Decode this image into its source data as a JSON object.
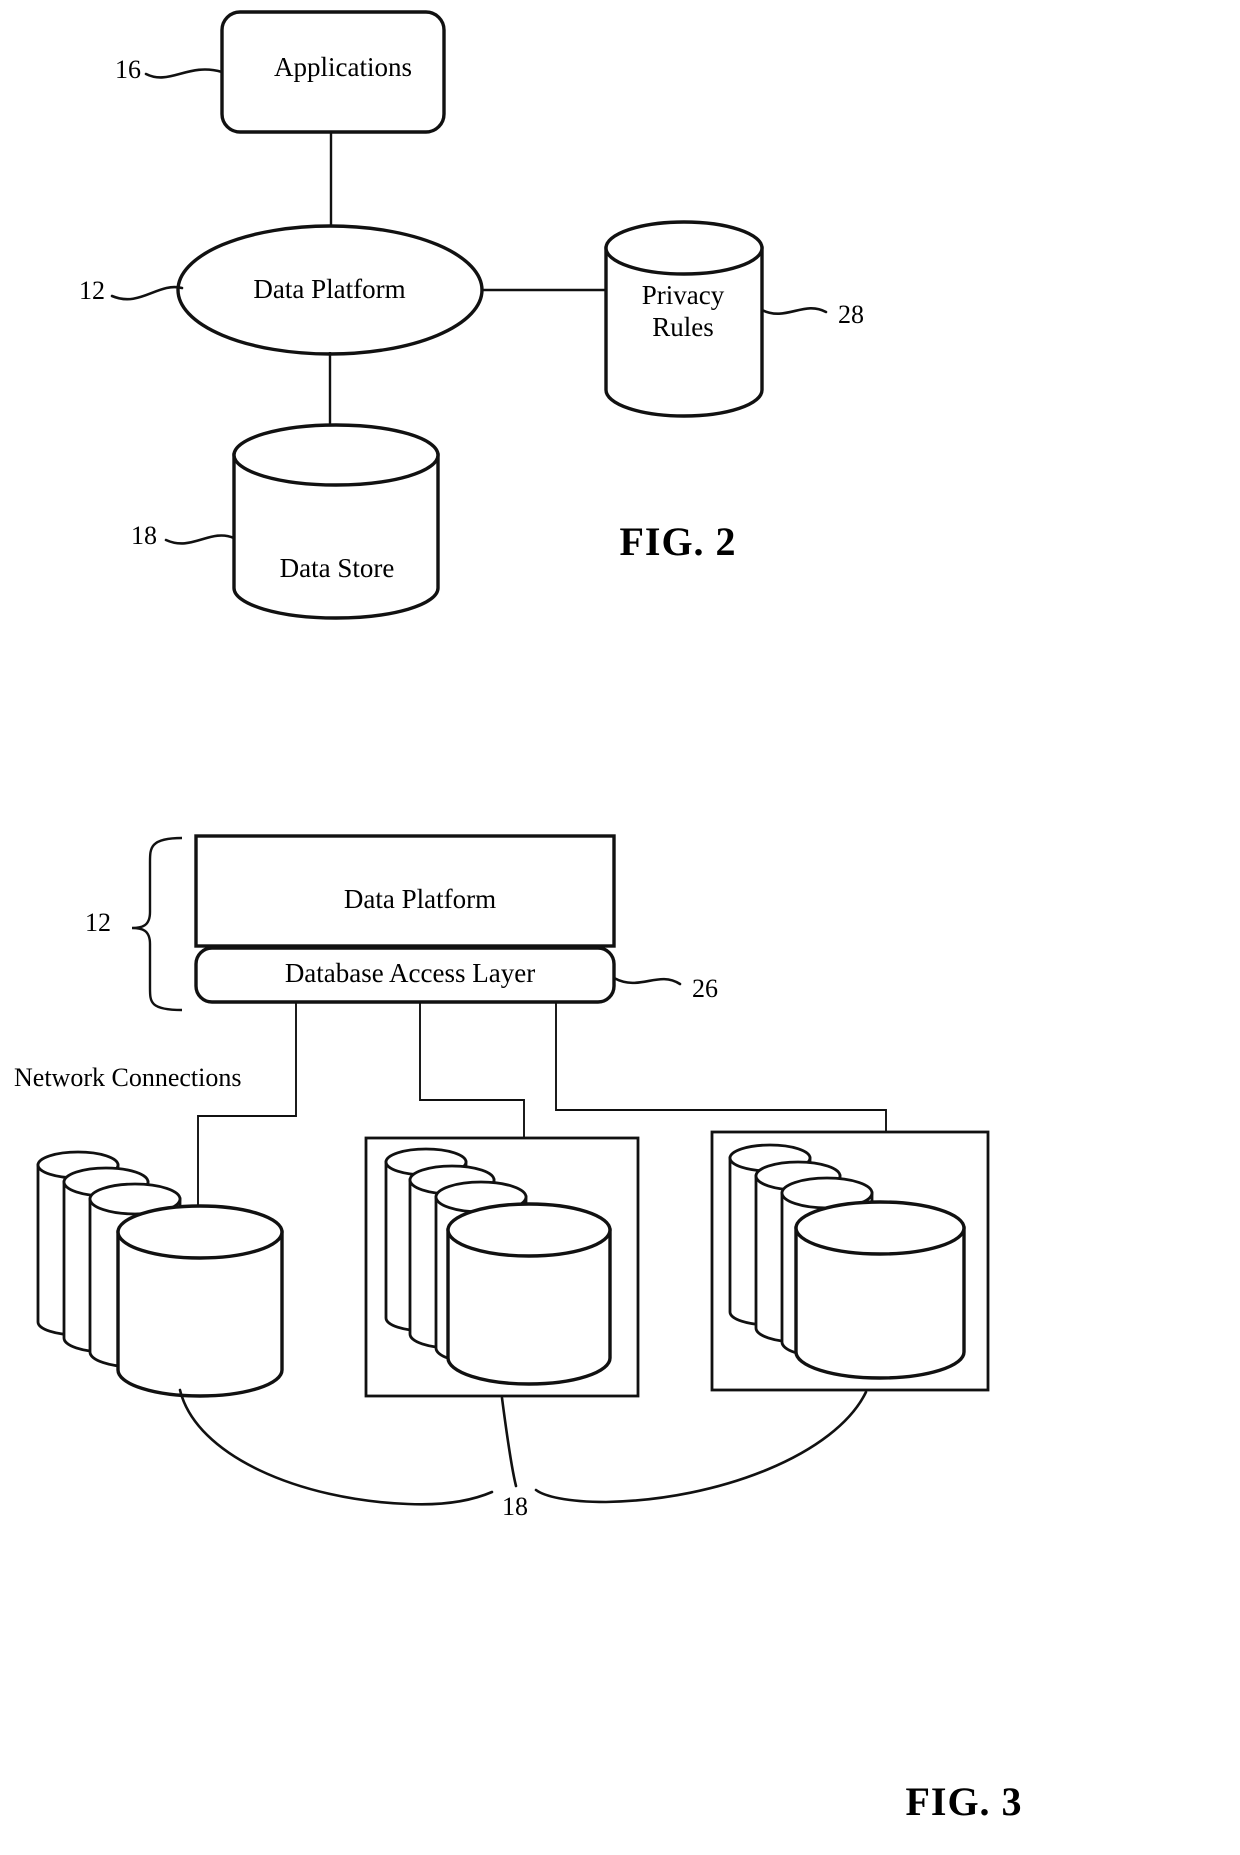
{
  "document": {
    "type": "patent-drawing-sheet",
    "figures": [
      "FIG. 2",
      "FIG. 3"
    ]
  },
  "fig2": {
    "caption": "FIG. 2",
    "nodes": {
      "applications": {
        "label": "Applications",
        "ref": "16",
        "shape": "rounded-rect"
      },
      "data_platform": {
        "label": "Data Platform",
        "ref": "12",
        "shape": "ellipse"
      },
      "privacy_rules": {
        "label": "Privacy Rules",
        "label_line1": "Privacy",
        "label_line2": "Rules",
        "ref": "28",
        "shape": "cylinder"
      },
      "data_store": {
        "label": "Data Store",
        "ref": "18",
        "shape": "cylinder"
      }
    },
    "connections": [
      {
        "from": "applications",
        "to": "data_platform"
      },
      {
        "from": "data_platform",
        "to": "privacy_rules"
      },
      {
        "from": "data_platform",
        "to": "data_store"
      }
    ]
  },
  "fig3": {
    "caption": "FIG. 3",
    "nodes": {
      "data_platform": {
        "label": "Data Platform",
        "ref": "12",
        "shape": "rect"
      },
      "database_access_layer": {
        "label": "Database Access Layer",
        "ref": "26",
        "shape": "rounded-rect"
      },
      "data_stores": {
        "ref": "18",
        "shape": "cylinder-stack-groups",
        "group_count": 3,
        "cylinders_per_group": 4
      }
    },
    "annotations": {
      "network_connections": "Network Connections"
    }
  },
  "colors": {
    "ink": "#000000",
    "paper": "#ffffff"
  }
}
